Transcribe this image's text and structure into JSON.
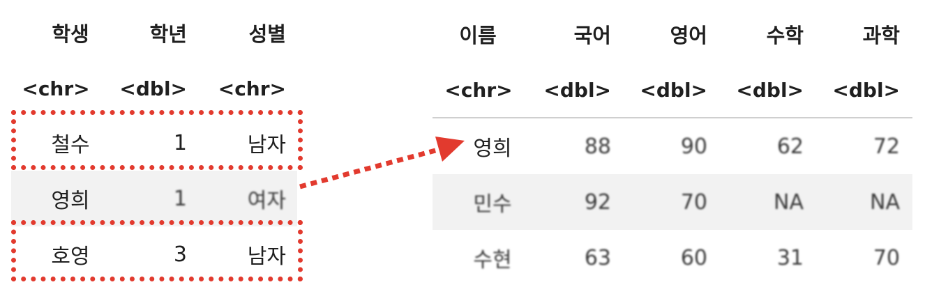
{
  "left_table": {
    "headers": [
      "학생",
      "학년",
      "성별"
    ],
    "types": [
      "<chr>",
      "<dbl>",
      "<chr>"
    ],
    "rows": [
      [
        "철수",
        "1",
        "남자"
      ],
      [
        "영희",
        "1",
        "여자"
      ],
      [
        "호영",
        "3",
        "남자"
      ]
    ]
  },
  "right_table": {
    "headers": [
      "이름",
      "국어",
      "영어",
      "수학",
      "과학"
    ],
    "types": [
      "<chr>",
      "<dbl>",
      "<dbl>",
      "<dbl>",
      "<dbl>"
    ],
    "rows": [
      [
        "영희",
        "88",
        "90",
        "62",
        "72"
      ],
      [
        "민수",
        "92",
        "70",
        "NA",
        "NA"
      ],
      [
        "수현",
        "63",
        "60",
        "31",
        "70"
      ]
    ]
  },
  "colors": {
    "highlight": "#e23a2e",
    "row_shade": "#f2f2f2",
    "rule": "#cfcfcf"
  },
  "highlighted_left_rows": [
    0,
    2
  ],
  "match": {
    "from": "영희",
    "to": "영희"
  }
}
